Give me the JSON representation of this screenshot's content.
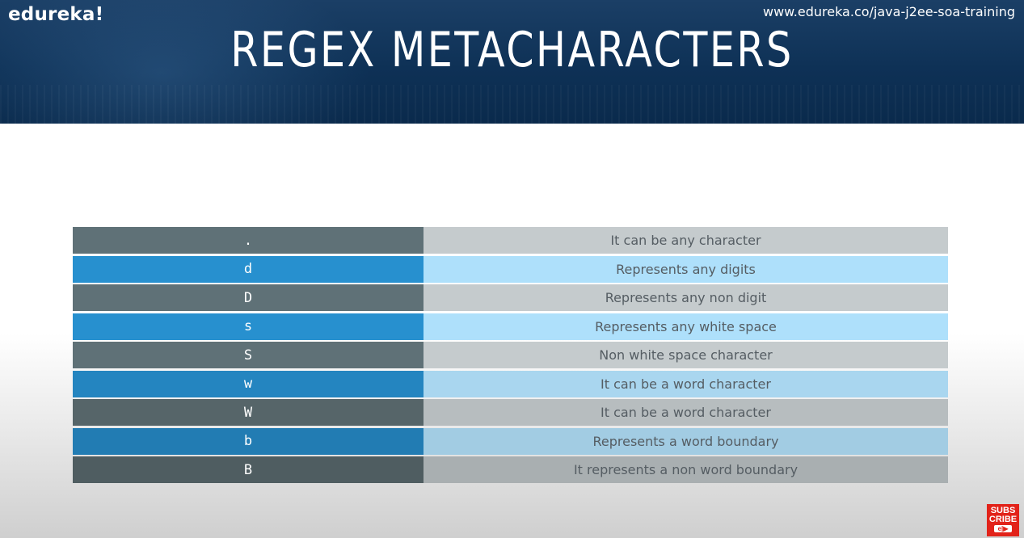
{
  "header": {
    "logo": "edureka!",
    "url": "www.edureka.co/java-j2ee-soa-training",
    "title": "REGEX METACHARACTERS"
  },
  "table": {
    "rows": [
      {
        "key": ".",
        "desc": "It can be any character"
      },
      {
        "key": "d",
        "desc": "Represents any digits"
      },
      {
        "key": "D",
        "desc": "Represents any non digit"
      },
      {
        "key": "s",
        "desc": "Represents any white space"
      },
      {
        "key": "S",
        "desc": "Non white space character"
      },
      {
        "key": "w",
        "desc": "It can be a word character"
      },
      {
        "key": "W",
        "desc": "It can be a word character"
      },
      {
        "key": "b",
        "desc": "Represents a word boundary"
      },
      {
        "key": "B",
        "desc": "It represents a non word boundary"
      }
    ]
  },
  "subscribe": {
    "line1": "SUBS",
    "line2": "CRIBE",
    "badge": "e|▶"
  },
  "colors": {
    "banner": "#0e3156",
    "key_gray": "#5f7177",
    "key_blue": "#2790cf",
    "desc_gray": "#c5cbcd",
    "desc_blue": "#aee0fb",
    "subscribe_red": "#e2231a"
  }
}
